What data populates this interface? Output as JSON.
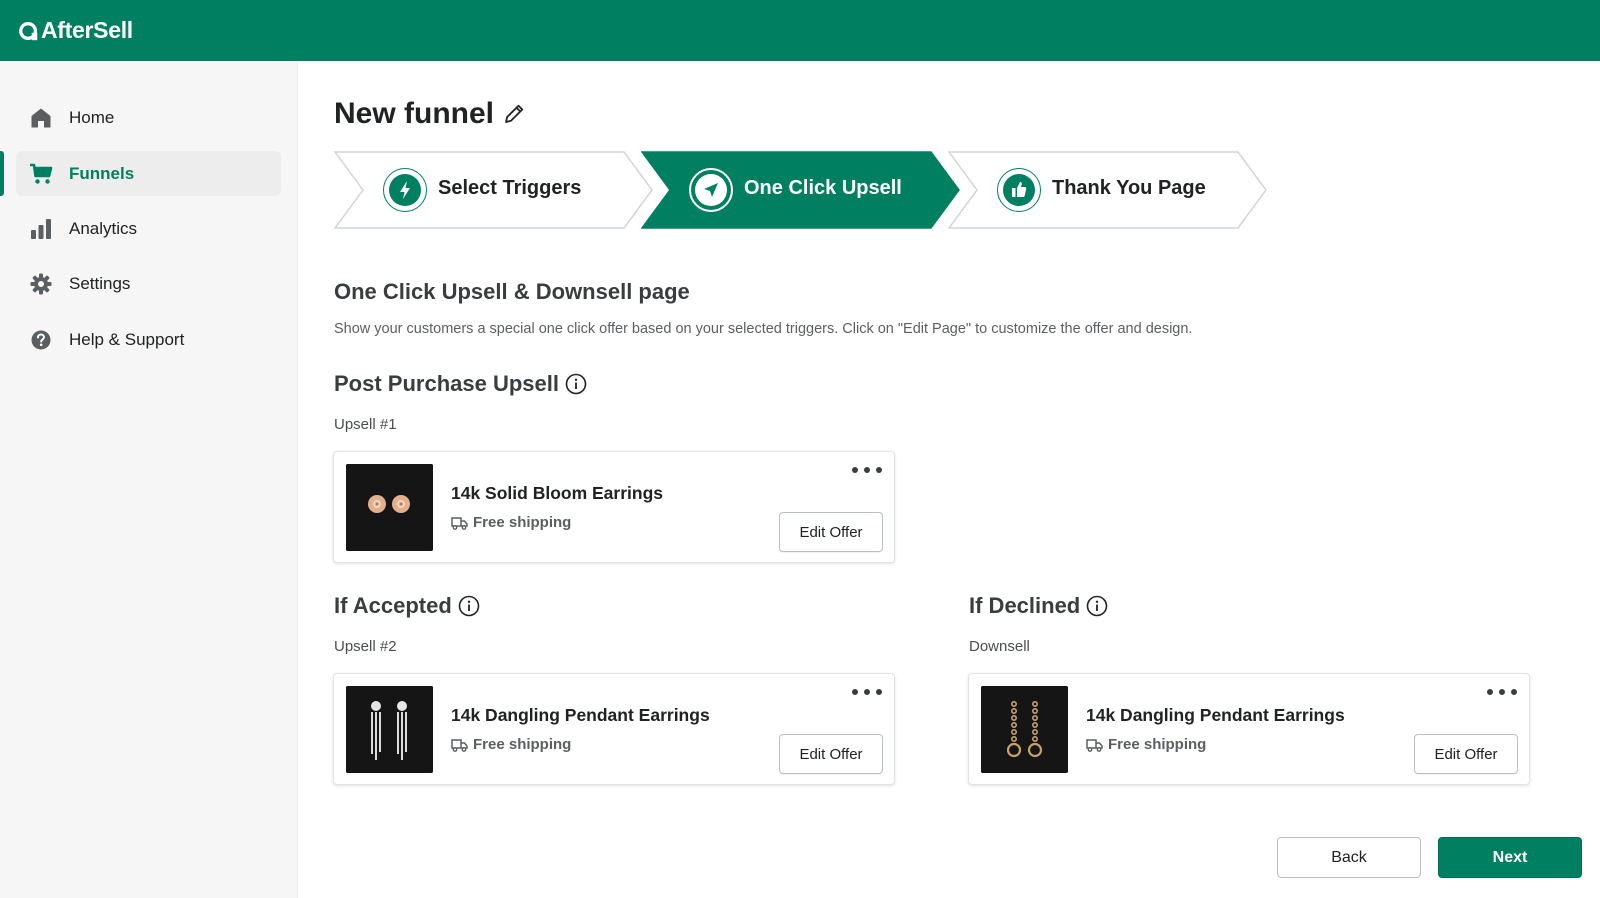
{
  "app": {
    "name": "AfterSell",
    "brand_color": "#008060"
  },
  "sidebar": {
    "items": [
      {
        "label": "Home",
        "icon": "home-icon",
        "active": false
      },
      {
        "label": "Funnels",
        "icon": "cart-icon",
        "active": true
      },
      {
        "label": "Analytics",
        "icon": "bar-chart-icon",
        "active": false
      },
      {
        "label": "Settings",
        "icon": "gear-icon",
        "active": false
      },
      {
        "label": "Help & Support",
        "icon": "question-icon",
        "active": false
      }
    ]
  },
  "page": {
    "title": "New funnel"
  },
  "steps": [
    {
      "label": "Select Triggers",
      "icon": "lightning-icon",
      "active": false
    },
    {
      "label": "One Click Upsell",
      "icon": "navigation-arrow-icon",
      "active": true
    },
    {
      "label": "Thank You Page",
      "icon": "thumbs-up-icon",
      "active": false
    }
  ],
  "section": {
    "title": "One Click Upsell & Downsell page",
    "description": "Show your customers a special one click offer based on your selected triggers. Click on \"Edit Page\" to customize the offer and design."
  },
  "post_purchase": {
    "title": "Post Purchase Upsell",
    "caption": "Upsell #1",
    "card": {
      "product": "14k Solid Bloom Earrings",
      "shipping": "Free shipping",
      "button": "Edit Offer"
    }
  },
  "accepted": {
    "title": "If Accepted",
    "caption": "Upsell #2",
    "card": {
      "product": "14k Dangling Pendant Earrings",
      "shipping": "Free shipping",
      "button": "Edit Offer"
    }
  },
  "declined": {
    "title": "If Declined",
    "caption": "Downsell",
    "card": {
      "product": "14k Dangling Pendant Earrings",
      "shipping": "Free shipping",
      "button": "Edit Offer"
    }
  },
  "footer": {
    "back_label": "Back",
    "next_label": "Next"
  }
}
